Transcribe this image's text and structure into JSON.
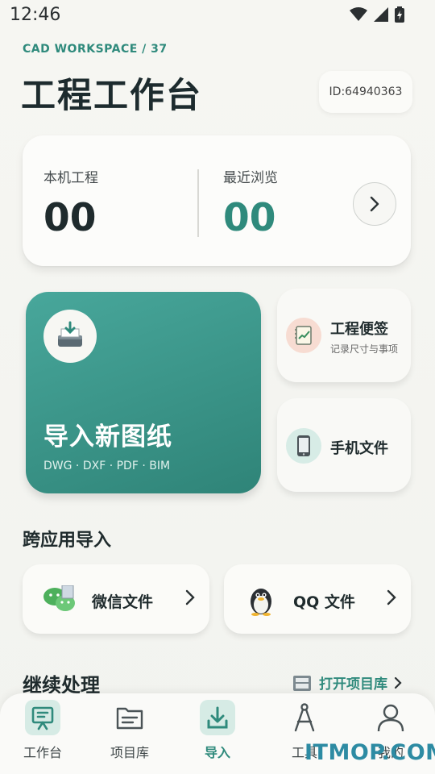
{
  "status_bar": {
    "time": "12:46"
  },
  "header": {
    "eyebrow": "CAD WORKSPACE / 37",
    "title": "工程工作台",
    "id_badge": "ID:64940363"
  },
  "stats": {
    "local_label": "本机工程",
    "local_value": "00",
    "recent_label": "最近浏览",
    "recent_value": "00"
  },
  "import_tile": {
    "title": "导入新图纸",
    "formats": "DWG · DXF · PDF · BIM"
  },
  "side_tiles": [
    {
      "title": "工程便签",
      "subtitle": "记录尺寸与事项"
    },
    {
      "title": "手机文件"
    }
  ],
  "cross_app": {
    "section_title": "跨应用导入",
    "items": [
      {
        "label": "微信文件"
      },
      {
        "label": "QQ 文件"
      }
    ]
  },
  "continue": {
    "title": "继续处理",
    "link": "打开项目库"
  },
  "bottom_nav": [
    {
      "label": "工作台",
      "icon": "workbench-icon"
    },
    {
      "label": "项目库",
      "icon": "folder-icon"
    },
    {
      "label": "导入",
      "icon": "import-icon"
    },
    {
      "label": "工具",
      "icon": "compass-icon"
    },
    {
      "label": "我的",
      "icon": "user-icon"
    }
  ],
  "watermark": "ITMOP.COM",
  "colors": {
    "accent": "#2f8a7c",
    "background": "#f4f4f0",
    "text": "#1f2b2d"
  }
}
